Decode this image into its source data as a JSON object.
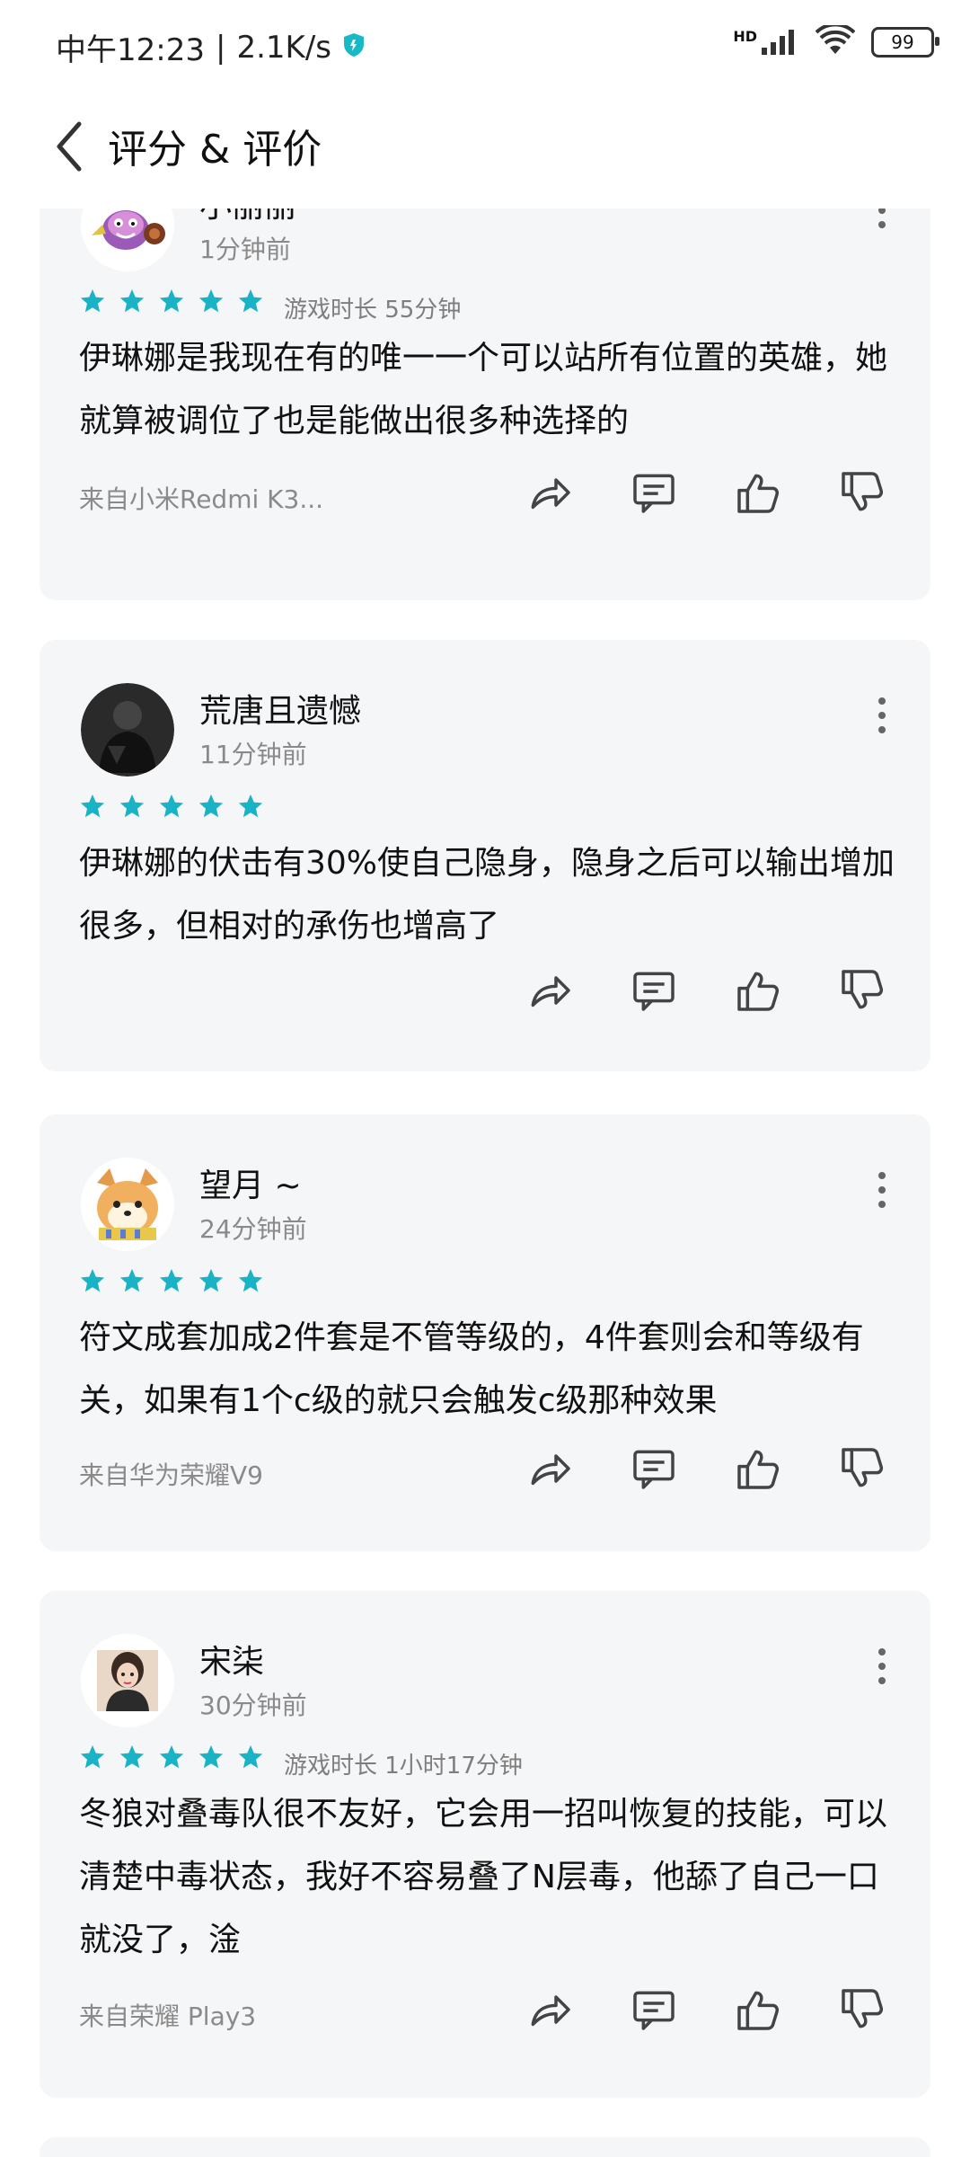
{
  "status": {
    "time": "中午12:23",
    "net": "2.1K/s",
    "battery": "99"
  },
  "header": {
    "title": "评分 & 评价"
  },
  "reviews": [
    {
      "name": "小丽丽",
      "time": "1分钟前",
      "rating": 5,
      "playtime": "游戏时长 55分钟",
      "content": "伊琳娜是我现在有的唯一一个可以站所有位置的英雄，她就算被调位了也是能做出很多种选择的",
      "device": "来自小米Redmi K3..."
    },
    {
      "name": "荒唐且遗憾",
      "time": "11分钟前",
      "rating": 5,
      "playtime": "",
      "content": "伊琳娜的伏击有30%使自己隐身，隐身之后可以输出增加很多，但相对的承伤也增高了",
      "device": ""
    },
    {
      "name": "望月 ~",
      "time": "24分钟前",
      "rating": 5,
      "playtime": "",
      "content": "符文成套加成2件套是不管等级的，4件套则会和等级有关，如果有1个c级的就只会触发c级那种效果",
      "device": "来自华为荣耀V9"
    },
    {
      "name": "宋柒",
      "time": "30分钟前",
      "rating": 5,
      "playtime": "游戏时长 1小时17分钟",
      "content": "冬狼对叠毒队很不友好，它会用一招叫恢复的技能，可以清楚中毒状态，我好不容易叠了N层毒，他舔了自己一口就没了，淦",
      "device": "来自荣耀 Play3"
    }
  ],
  "colors": {
    "star": "#1ab3c6",
    "card": "#f5f6f8",
    "muted": "#8a8a8a"
  }
}
